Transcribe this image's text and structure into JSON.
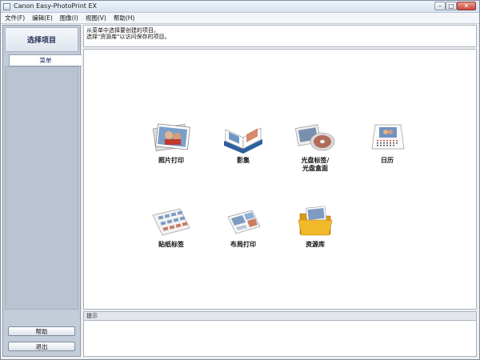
{
  "window": {
    "title": "Canon Easy-PhotoPrint EX",
    "controls": {
      "minimize": "–",
      "maximize": "□",
      "close": "✕"
    }
  },
  "menubar": {
    "items": [
      "文件(F)",
      "编辑(E)",
      "图像(I)",
      "视图(V)",
      "帮助(H)"
    ]
  },
  "sidebar": {
    "title": "选择项目",
    "tab": "菜单",
    "help_button": "帮助",
    "exit_button": "退出"
  },
  "message": {
    "line1": "从菜单中选择要创建的项目。",
    "line2": "选择\"资源库\"以访问保存的项目。"
  },
  "items": {
    "photo_print": {
      "label": "照片打印",
      "icon": "photo-stack-icon"
    },
    "album": {
      "label": "影集",
      "icon": "photo-album-icon"
    },
    "disc": {
      "label": "光盘标签/\n光盘盒面",
      "line1": "光盘标签/",
      "line2": "光盘盒面",
      "icon": "cd-label-icon"
    },
    "calendar": {
      "label": "日历",
      "icon": "calendar-icon"
    },
    "sticker": {
      "label": "贴纸标签",
      "icon": "sticker-sheet-icon"
    },
    "layout": {
      "label": "布局打印",
      "icon": "layout-print-icon"
    },
    "library": {
      "label": "资源库",
      "icon": "folder-icon"
    }
  },
  "hint": {
    "label": "提示"
  },
  "colors": {
    "sidebar_bg": "#c3ccd9",
    "title_text": "#1b2a4a",
    "folder_yellow": "#f1b92a"
  }
}
